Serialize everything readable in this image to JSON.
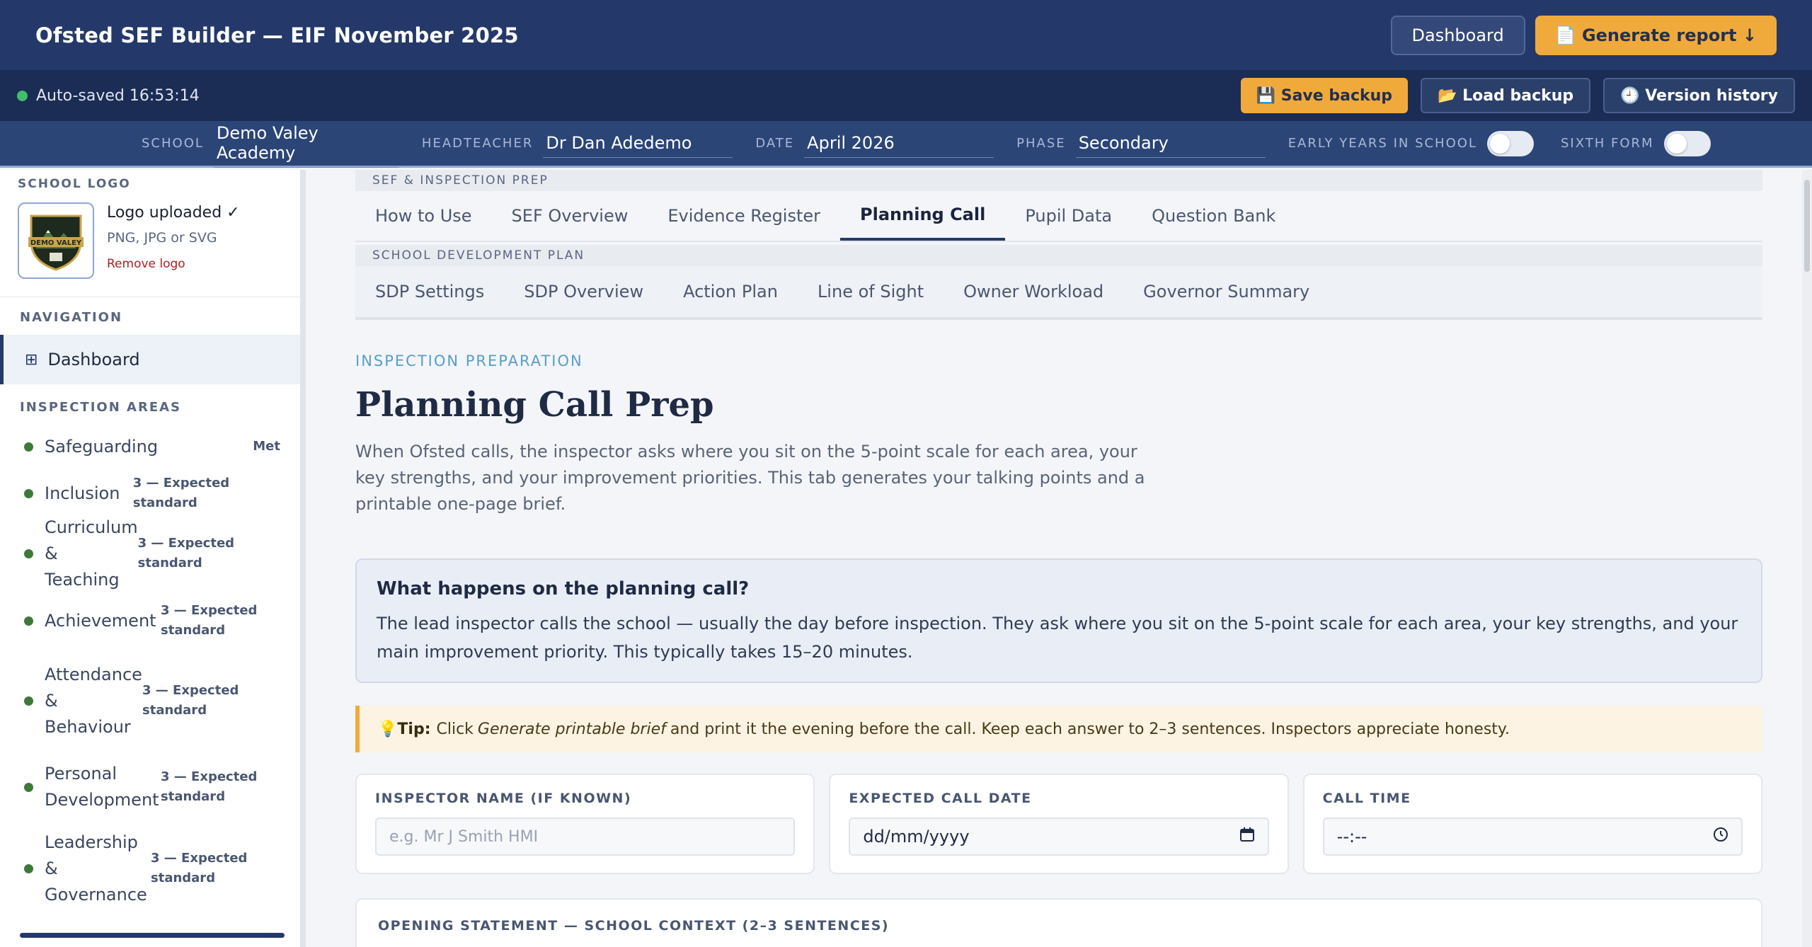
{
  "app": {
    "title": "Ofsted SEF Builder — EIF November 2025"
  },
  "top_actions": {
    "dashboard": "Dashboard",
    "generate": "📄 Generate report ↓"
  },
  "status": {
    "autosave": "Auto-saved 16:53:14",
    "save_backup": "💾 Save backup",
    "load_backup": "📂 Load backup",
    "version_history": "🕘 Version history"
  },
  "info": {
    "school_label": "SCHOOL",
    "school": "Demo Valey Academy",
    "head_label": "HEADTEACHER",
    "head": "Dr Dan Adedemo",
    "date_label": "DATE",
    "date": "April 2026",
    "phase_label": "PHASE",
    "phase": "Secondary",
    "early_years_label": "EARLY YEARS IN SCHOOL",
    "early_years_on": false,
    "sixth_form_label": "SIXTH FORM",
    "sixth_form_on": false
  },
  "sidebar": {
    "logo_section": "SCHOOL LOGO",
    "logo_badge_text": "DEMO VALEY",
    "logo_uploaded": "Logo uploaded ✓",
    "logo_formats": "PNG, JPG or SVG",
    "remove_logo": "Remove logo",
    "nav_label": "NAVIGATION",
    "dashboard": "Dashboard",
    "areas_label": "INSPECTION AREAS",
    "areas": [
      {
        "name": "Safeguarding",
        "status": "Met"
      },
      {
        "name": "Inclusion",
        "status": "3 — Expected standard"
      },
      {
        "name": "Curriculum & Teaching",
        "status": "3 — Expected standard"
      },
      {
        "name": "Achievement",
        "status": "3 — Expected standard"
      },
      {
        "name": "Attendance & Behaviour",
        "status": "3 — Expected standard"
      },
      {
        "name": "Personal Development",
        "status": "3 — Expected standard"
      },
      {
        "name": "Leadership & Governance",
        "status": "3 — Expected standard"
      }
    ],
    "status_color": "#3d7a3a"
  },
  "tabs": {
    "group1_label": "SEF & INSPECTION PREP",
    "group1": [
      "How to Use",
      "SEF Overview",
      "Evidence Register",
      "Planning Call",
      "Pupil Data",
      "Question Bank"
    ],
    "active": "Planning Call",
    "group2_label": "SCHOOL DEVELOPMENT PLAN",
    "group2": [
      "SDP Settings",
      "SDP Overview",
      "Action Plan",
      "Line of Sight",
      "Owner Workload",
      "Governor Summary"
    ]
  },
  "page": {
    "eyebrow": "INSPECTION PREPARATION",
    "title": "Planning Call Prep",
    "intro": "When Ofsted calls, the inspector asks where you sit on the 5-point scale for each area, your key strengths, and your improvement priorities. This tab generates your talking points and a printable one-page brief.",
    "info_title": "What happens on the planning call?",
    "info_body": "The lead inspector calls the school — usually the day before inspection. They ask where you sit on the 5-point scale for each area, your key strengths, and your main improvement priority. This typically takes 15–20 minutes.",
    "tip_icon": "💡",
    "tip_label": "Tip:",
    "tip_pre": "Click",
    "tip_em": "Generate printable brief",
    "tip_post": "and print it the evening before the call. Keep each answer to 2–3 sentences. Inspectors appreciate honesty."
  },
  "form": {
    "inspector_label": "INSPECTOR NAME (IF KNOWN)",
    "inspector_placeholder": "e.g. Mr J Smith HMI",
    "date_label": "EXPECTED CALL DATE",
    "date_value": "dd/mm/yyyy",
    "time_label": "CALL TIME",
    "time_value": "--:--",
    "statement_label": "OPENING STATEMENT — SCHOOL CONTEXT (2–3 SENTENCES)"
  },
  "colors": {
    "navy": "#24396a",
    "accent": "#f0aa3c",
    "eyebrow": "#5a9ec7"
  }
}
